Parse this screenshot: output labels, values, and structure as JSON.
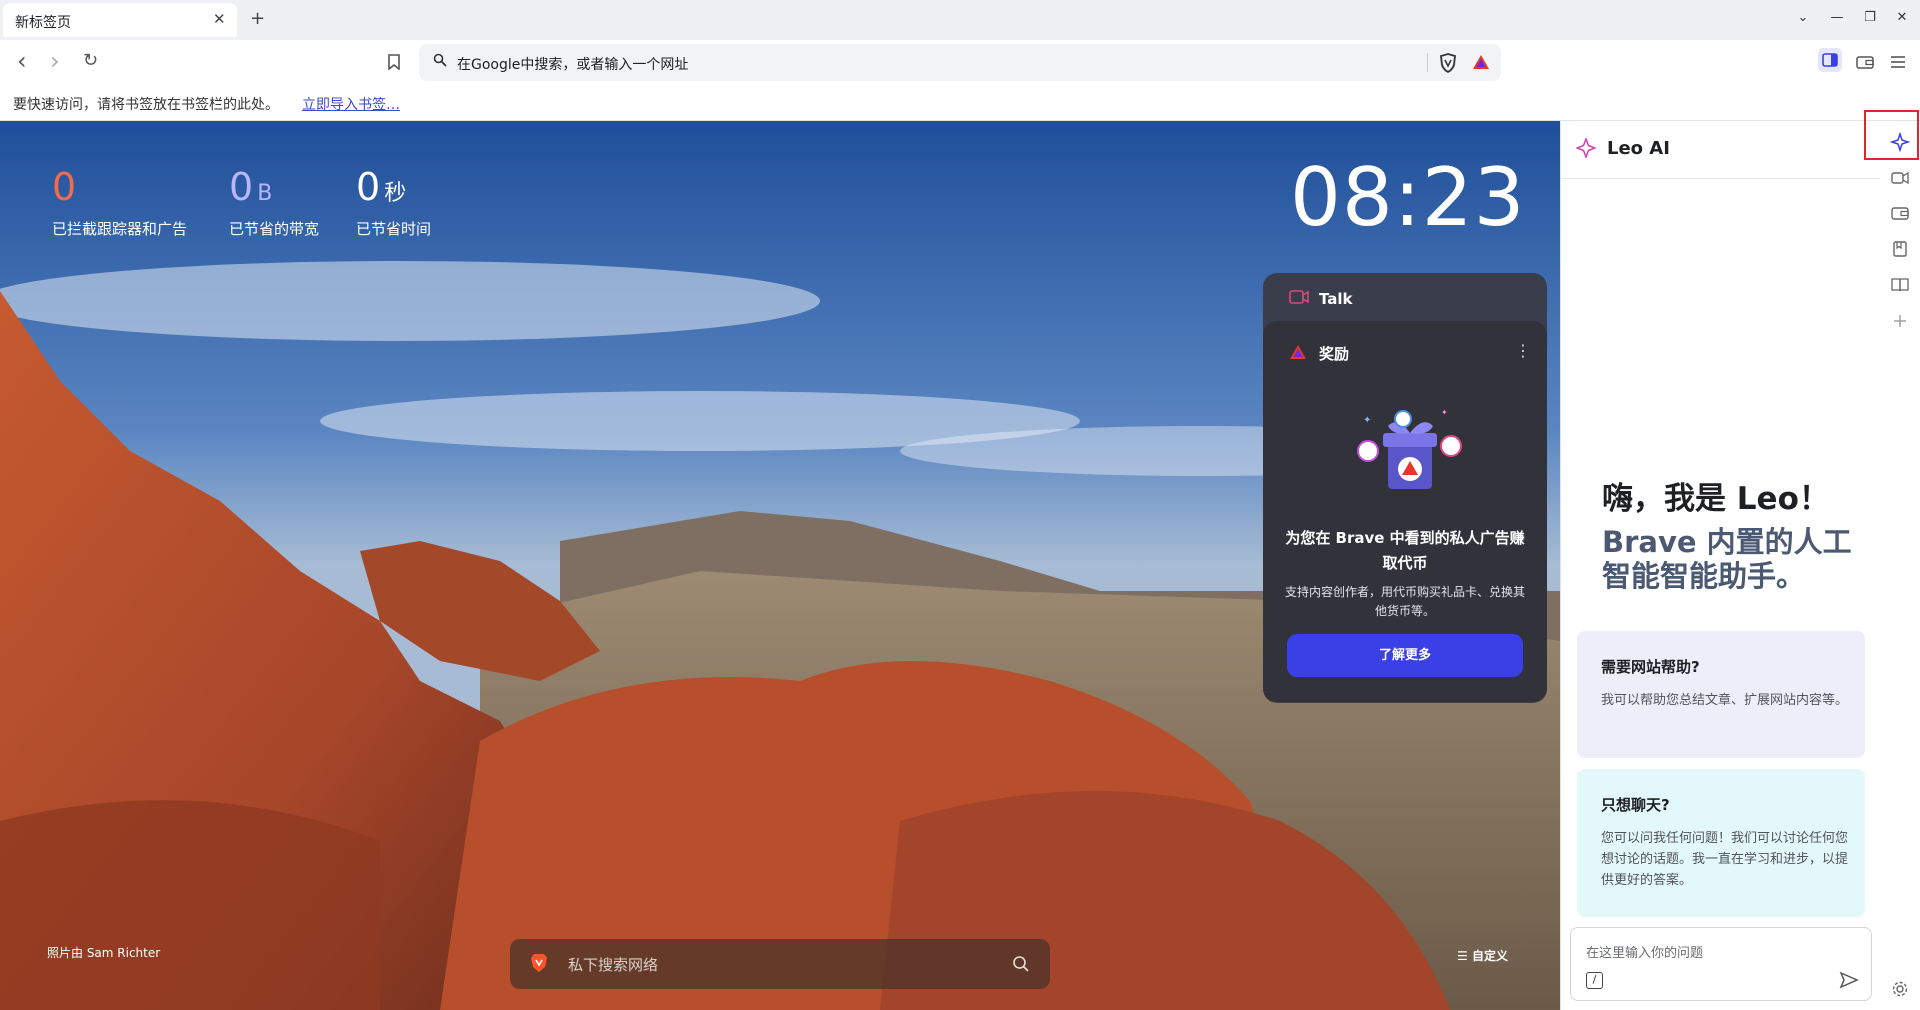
{
  "tab": {
    "title": "新标签页",
    "close": "✕",
    "new_tab": "+"
  },
  "window_controls": {
    "list": "⌄",
    "minimize": "—",
    "restore": "❐",
    "close": "✕"
  },
  "toolbar": {
    "back": "‹",
    "forward": "›",
    "reload": "↻"
  },
  "omnibox": {
    "placeholder": "在Google中搜索，或者输入一个网址"
  },
  "bookmarks_bar": {
    "hint": "要快速访问，请将书签放在书签栏的此处。",
    "import_link": "立即导入书签…"
  },
  "stats": [
    {
      "value": "0",
      "unit": "",
      "label": "已拦截跟踪器和广告",
      "color": "#f26b4a"
    },
    {
      "value": "0",
      "unit": "B",
      "label": "已节省的带宽",
      "color": "#b8b6ff"
    },
    {
      "value": "0",
      "unit": "秒",
      "label": "已节省时间",
      "color": "#ffffff"
    }
  ],
  "clock": "08:23",
  "talk_card": {
    "title": "Talk"
  },
  "rewards_card": {
    "title": "奖励",
    "headline": "为您在 Brave 中看到的私人广告赚取代币",
    "description": "支持内容创作者，用代币购买礼品卡、兑换其他货币等。",
    "button": "了解更多"
  },
  "photo_credit": "照片由 Sam Richter",
  "ntp_search": {
    "placeholder": "私下搜索网络"
  },
  "customize": "自定义",
  "leo": {
    "title": "Leo AI",
    "greeting": "嗨，我是 Leo！",
    "subtitle": "Brave 内置的人工智能智能助手。",
    "cards": [
      {
        "title": "需要网站帮助?",
        "body": "我可以帮助您总结文章、扩展网站内容等。"
      },
      {
        "title": "只想聊天?",
        "body": "您可以问我任何问题！我们可以讨论任何您想讨论的话题。我一直在学习和进步，以提供更好的答案。"
      }
    ],
    "input_placeholder": "在这里输入你的问题",
    "slash": "/"
  },
  "colors": {
    "accent": "#3b3fe6",
    "highlight": "#e0262b",
    "brave_orange": "#fb542b"
  }
}
